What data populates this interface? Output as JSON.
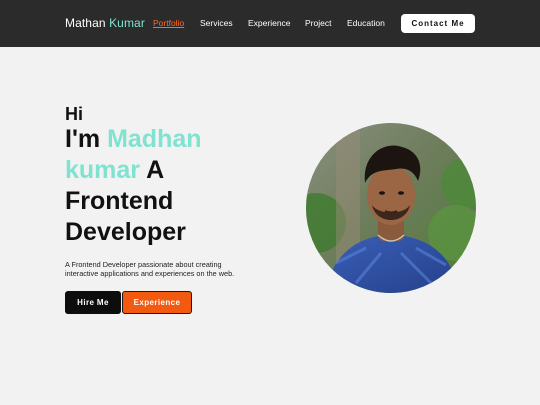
{
  "navbar": {
    "brand_first": "Mathan",
    "brand_last": "Kumar",
    "links": [
      {
        "label": "Portfolio",
        "active": true
      },
      {
        "label": "Services",
        "active": false
      },
      {
        "label": "Experience",
        "active": false
      },
      {
        "label": "Project",
        "active": false
      },
      {
        "label": "Education",
        "active": false
      }
    ],
    "cta_label": "Contact Me"
  },
  "hero": {
    "greeting": "Hi",
    "intro": "I'm",
    "name": "Madhan kumar",
    "role_line": "A Frontend Developer",
    "description": "A Frontend Developer passionate about creating interactive applications and experiences on the web.",
    "primary_button": "Hire Me",
    "secondary_button": "Experience"
  },
  "colors": {
    "nav_bg": "#2b2b2b",
    "accent_mint": "#7fe3cf",
    "accent_orange": "#f25a12",
    "page_bg": "#f2f2f2"
  }
}
